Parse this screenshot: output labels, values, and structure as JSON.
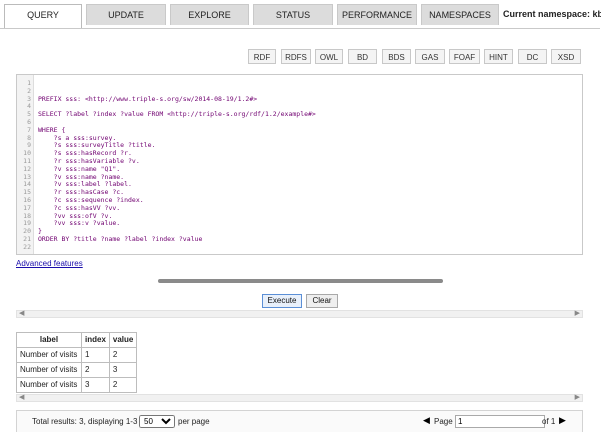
{
  "tabs": [
    {
      "label": "QUERY",
      "active": true
    },
    {
      "label": "UPDATE"
    },
    {
      "label": "EXPLORE"
    },
    {
      "label": "STATUS"
    },
    {
      "label": "PERFORMANCE"
    },
    {
      "label": "NAMESPACES"
    }
  ],
  "current_namespace": "Current namespace: kb",
  "prefix_buttons": [
    "RDF",
    "RDFS",
    "OWL",
    "BD",
    "BDS",
    "GAS",
    "FOAF",
    "HINT",
    "DC",
    "XSD"
  ],
  "query_lines": [
    "",
    "",
    "PREFIX sss: <http://www.triple-s.org/sw/2014-08-19/1.2#>",
    "",
    "SELECT ?label ?index ?value FROM <http://triple-s.org/rdf/1.2/example#>",
    "",
    "WHERE {",
    "    ?s a sss:survey.",
    "    ?s sss:surveyTitle ?title.",
    "    ?s sss:hasRecord ?r.",
    "    ?r sss:hasVariable ?v.",
    "    ?v sss:name \"Q1\".",
    "    ?v sss:name ?name.",
    "    ?v sss:label ?label.",
    "    ?r sss:hasCase ?c.",
    "    ?c sss:sequence ?index.",
    "    ?c sss:hasVV ?vv.",
    "    ?vv sss:ofV ?v.",
    "    ?vv sss:v ?value.",
    "}",
    "ORDER BY ?title ?name ?label ?index ?value",
    ""
  ],
  "advanced_link": "Advanced features",
  "execute_label": "Execute",
  "clear_label": "Clear",
  "results": {
    "headers": [
      "label",
      "index",
      "value"
    ],
    "rows": [
      [
        "Number of visits",
        "1",
        "2"
      ],
      [
        "Number of visits",
        "2",
        "3"
      ],
      [
        "Number of visits",
        "3",
        "2"
      ]
    ]
  },
  "pager": {
    "total_text": "Total results: 3, displaying 1-3",
    "page_size": "50",
    "per_page": "per page",
    "page_label": "Page",
    "page_value": "1",
    "of_label": "of 1"
  }
}
